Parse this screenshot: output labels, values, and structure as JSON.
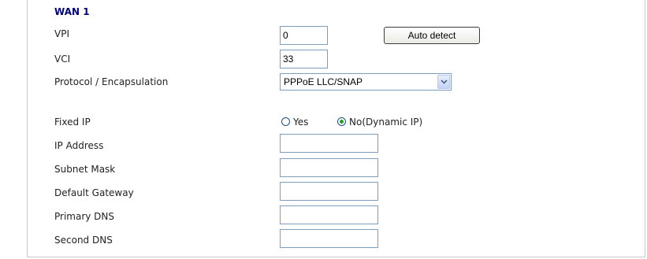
{
  "section": {
    "title": "WAN 1"
  },
  "vpi": {
    "label": "VPI",
    "value": "0"
  },
  "auto_detect": {
    "label": "Auto detect"
  },
  "vci": {
    "label": "VCI",
    "value": "33"
  },
  "protocol": {
    "label": "Protocol / Encapsulation",
    "selected": "PPPoE LLC/SNAP"
  },
  "fixed_ip": {
    "label": "Fixed IP",
    "options": [
      "Yes",
      "No(Dynamic IP)"
    ],
    "selected": "No(Dynamic IP)"
  },
  "ip_address": {
    "label": "IP Address",
    "value": ""
  },
  "subnet_mask": {
    "label": "Subnet Mask",
    "value": ""
  },
  "default_gateway": {
    "label": "Default Gateway",
    "value": ""
  },
  "primary_dns": {
    "label": "Primary DNS",
    "value": ""
  },
  "second_dns": {
    "label": "Second DNS",
    "value": ""
  },
  "colors": {
    "title": "#000080",
    "border": "#7f9db9",
    "radio_dot": "#21a121"
  }
}
